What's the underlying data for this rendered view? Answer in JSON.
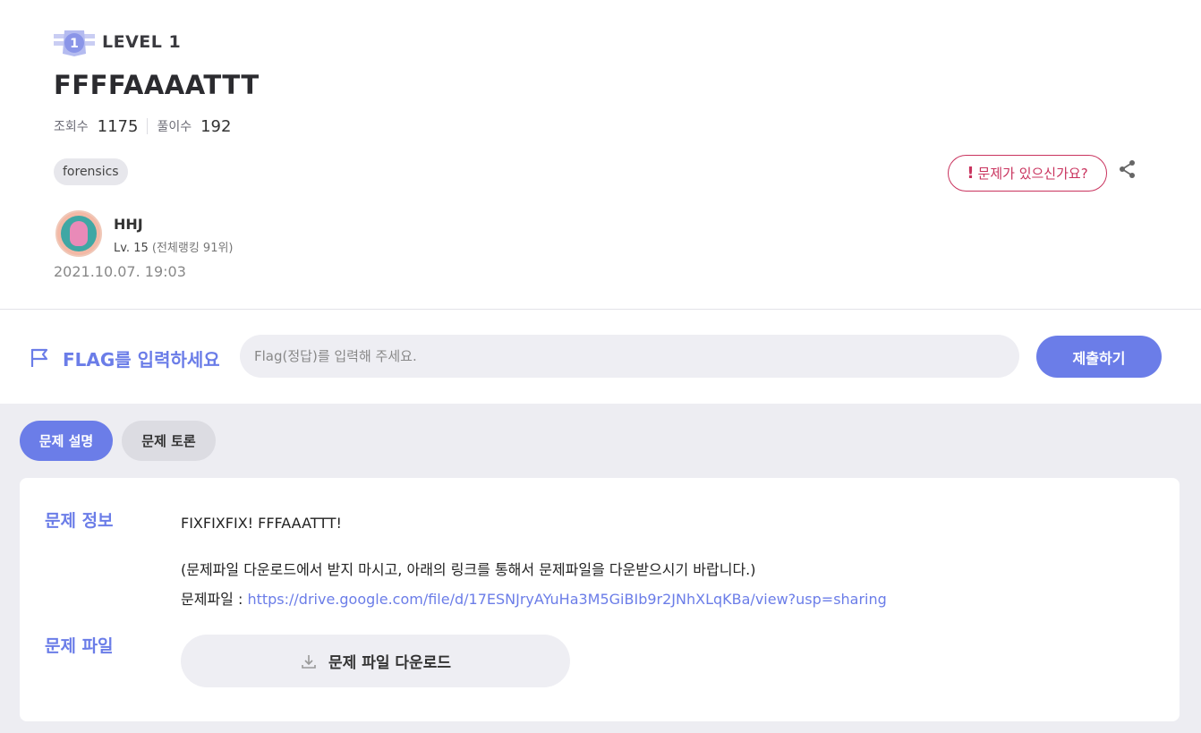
{
  "header": {
    "level_number": "1",
    "level_label": "LEVEL 1",
    "title": "FFFFAAAATTT",
    "views_label": "조회수",
    "views_value": "1175",
    "solves_label": "풀이수",
    "solves_value": "192",
    "tag": "forensics",
    "report_icon": "!",
    "report_label": "문제가 있으신가요?",
    "share_icon": "share-icon"
  },
  "author": {
    "name": "HHJ",
    "level": "Lv. 15",
    "rank": "(전체랭킹 91위)",
    "date": "2021.10.07. 19:03"
  },
  "flag": {
    "label": "FLAG를 입력하세요",
    "placeholder": "Flag(정답)를 입력해 주세요.",
    "submit": "제출하기"
  },
  "tabs": [
    {
      "label": "문제 설명",
      "active": true
    },
    {
      "label": "문제 토론",
      "active": false
    }
  ],
  "problem": {
    "info_label": "문제 정보",
    "line1": "FIXFIXFIX! FFFAAATTT!",
    "line2": "(문제파일 다운로드에서 받지 마시고, 아래의 링크를 통해서 문제파일을 다운받으시기 바랍니다.)",
    "line3_prefix": "문제파일 : ",
    "link": "https://drive.google.com/file/d/17ESNJryAYuHa3M5GiBIb9r2JNhXLqKBa/view?usp=sharing",
    "file_label": "문제 파일",
    "download_button": "문제 파일 다운로드"
  },
  "colors": {
    "accent": "#6b7de8",
    "report": "#c9335e",
    "lower_bg": "#ededf2"
  }
}
